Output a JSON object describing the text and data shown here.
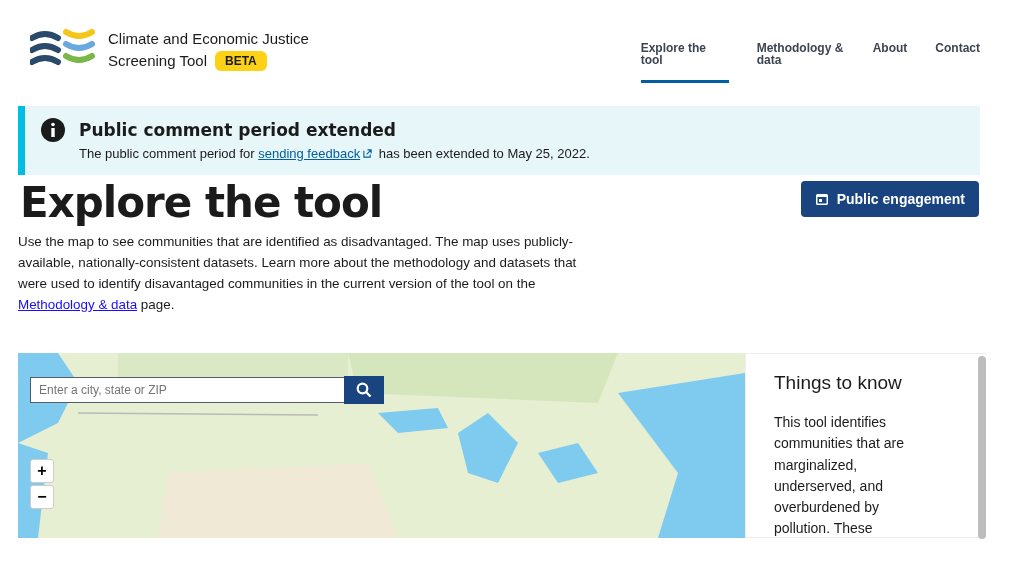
{
  "header": {
    "title_line1": "Climate and Economic Justice",
    "title_line2": "Screening Tool",
    "badge": "BETA"
  },
  "nav": [
    {
      "label": "Explore the tool",
      "selected": true
    },
    {
      "label": "Methodology & data",
      "selected": false
    },
    {
      "label": "About",
      "selected": false
    },
    {
      "label": "Contact",
      "selected": false
    }
  ],
  "alert": {
    "heading": "Public comment period extended",
    "text_before": "The public comment period for",
    "link": "sending feedback",
    "text_after": "has been extended to May 25, 2022."
  },
  "page": {
    "title": "Explore the tool",
    "button": "Public engagement",
    "intro_before": "Use the map to see communities that are identified as disadvantaged. The map uses publicly-available, nationally-consistent datasets. Learn more about the methodology and datasets that were used to identify disavantaged communities in the current version of the tool on the",
    "intro_link": "Methodology & data",
    "intro_after": "page."
  },
  "map": {
    "kind": "picture",
    "search_placeholder": "Enter a city, state or ZIP",
    "zoom_in": "+",
    "zoom_out": "−"
  },
  "side_panel": {
    "heading": "Things to know",
    "text": "This tool identifies communities that are marginalized, underserved, and overburdened by pollution. These"
  }
}
